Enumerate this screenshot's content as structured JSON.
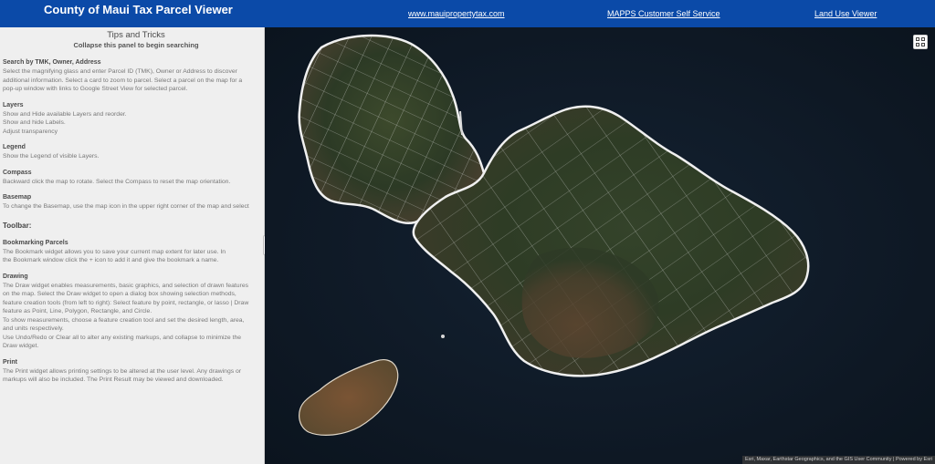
{
  "header": {
    "title": "County of Maui Tax Parcel Viewer",
    "links": [
      "www.mauipropertytax.com",
      "MAPPS Customer Self Service",
      "Land Use Viewer"
    ]
  },
  "panel": {
    "title": "Tips and Tricks",
    "subtitle": "Collapse this panel to begin searching",
    "sections": [
      {
        "heading": "Search by TMK, Owner, Address",
        "lines": [
          "Select the magnifying glass and enter Parcel ID (TMK), Owner or Address to discover",
          "additional information. Select a card to zoom to parcel. Select a parcel on the map for a",
          "pop-up window with links to  Google Street View for selected parcel."
        ]
      },
      {
        "heading": "Layers",
        "lines": [
          "Show and Hide available Layers  and reorder.",
          "Show and hide Labels.",
          "Adjust transparency"
        ]
      },
      {
        "heading": "Legend",
        "lines": [
          "Show the Legend of visible Layers."
        ]
      },
      {
        "heading": "Compass",
        "lines": [
          "Backward click the map to rotate. Select the Compass to reset the map orientation."
        ]
      },
      {
        "heading": "Basemap",
        "lines": [
          "To change the Basemap, use the map icon in the upper right corner of the map and select"
        ]
      }
    ],
    "toolbar_heading": "Toolbar:",
    "toolbar_sections": [
      {
        "heading": "Bookmarking Parcels",
        "lines": [
          "The Bookmark widget allows you to save your current map extent for later use.  In",
          "the Bookmark window  click the + icon to add it and give the bookmark a name."
        ]
      },
      {
        "heading": "Drawing",
        "lines": [
          "The Draw widget enables measurements, basic graphics, and selection of drawn features",
          "on the map. Select the Draw widget to open a dialog box showing selection methods,",
          "feature creation tools (from left to right): Select feature by point, rectangle, or lasso | Draw",
          "feature as Point, Line, Polygon, Rectangle, and Circle.",
          "To show measurements, choose a feature creation tool and set the desired length, area,",
          "and units respectively.",
          "Use Undo/Redo or Clear all to alter any existing markups, and collapse to minimize the",
          "Draw widget."
        ]
      },
      {
        "heading": "Print",
        "lines": [
          "The Print widget allows printing settings to be altered at the user level. Any drawings or",
          "markups will also be included. The Print Result may be viewed and downloaded."
        ]
      }
    ]
  },
  "collapse_handle": {
    "icon": "chevron-left-icon",
    "glyph": "‹"
  },
  "map": {
    "basemap_button_icon": "basemap-grid-icon",
    "attribution": "Esri, Maxar, Earthstar Geographics, and the GIS User Community | Powered by Esri",
    "colors": {
      "ocean": "#0e1824",
      "land_dark": "#2f3d26",
      "land_brown": "#6b4a2e",
      "parcel_line": "#e8e8e8"
    }
  }
}
